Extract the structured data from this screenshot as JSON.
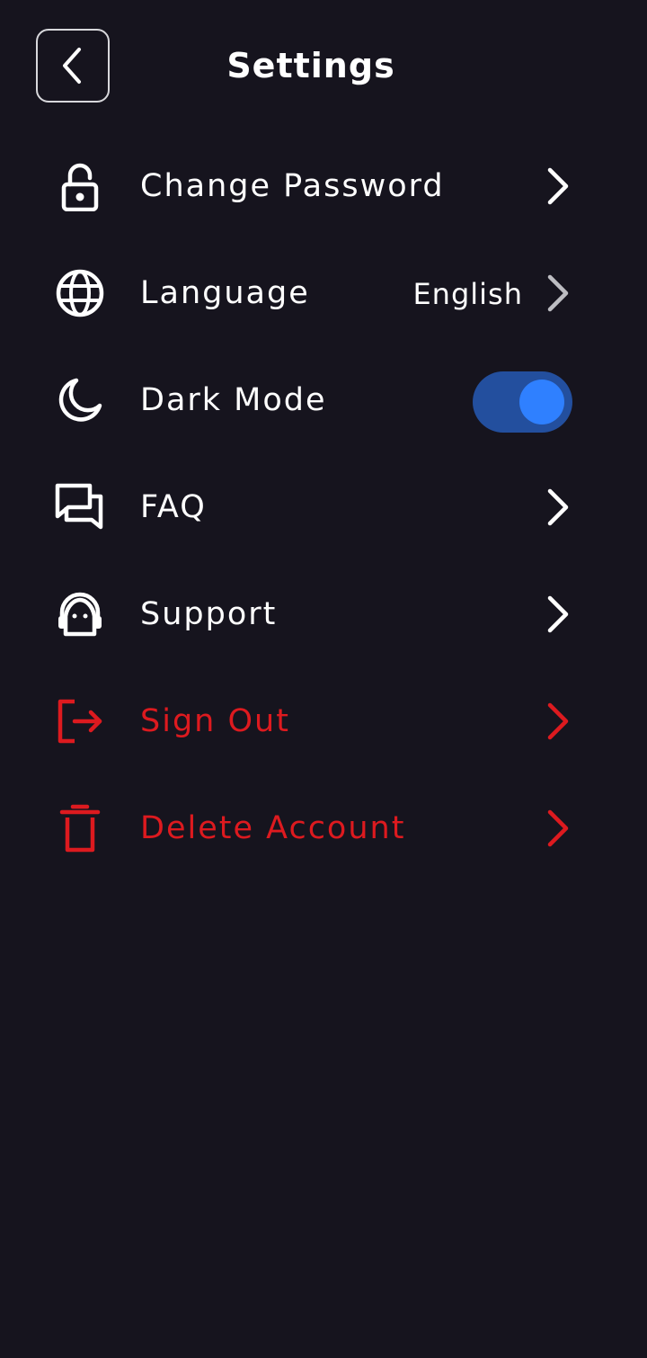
{
  "header": {
    "title": "Settings",
    "back_icon": "chevron-left-icon"
  },
  "items": [
    {
      "label": "Change Password",
      "icon": "lock-icon",
      "trailing": "chevron"
    },
    {
      "label": "Language",
      "icon": "globe-icon",
      "value": "English",
      "trailing": "chevron"
    },
    {
      "label": "Dark Mode",
      "icon": "moon-icon",
      "trailing": "toggle",
      "toggle_on": true
    },
    {
      "label": "FAQ",
      "icon": "chat-bubbles-icon",
      "trailing": "chevron"
    },
    {
      "label": "Support",
      "icon": "support-agent-icon",
      "trailing": "chevron"
    },
    {
      "label": "Sign Out",
      "icon": "sign-out-icon",
      "trailing": "chevron",
      "danger": true
    },
    {
      "label": "Delete Account",
      "icon": "trash-icon",
      "trailing": "chevron",
      "danger": true
    }
  ],
  "colors": {
    "background": "#16141e",
    "text": "#ffffff",
    "danger": "#dd1a1f",
    "toggle_track": "#234f9e",
    "toggle_knob": "#2f80ff",
    "muted_chevron": "#bdbdc2"
  }
}
